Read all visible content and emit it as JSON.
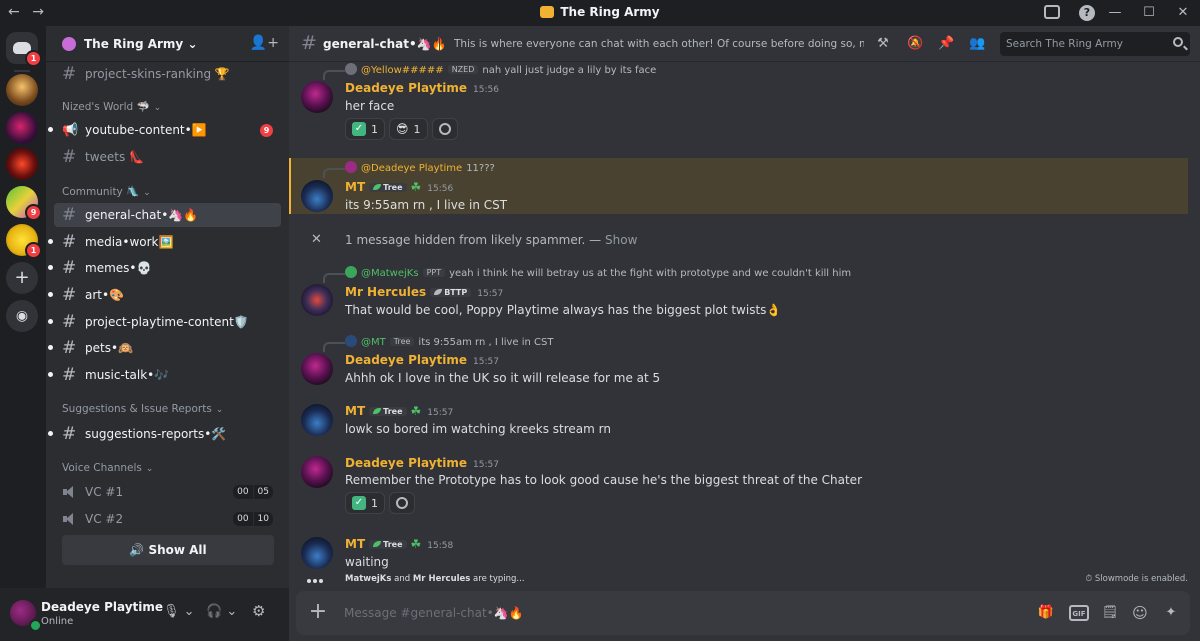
{
  "window": {
    "title": "The Ring Army",
    "back": "←",
    "forward": "→",
    "help": "?",
    "minimize": "—",
    "maximize": "☐",
    "close": "✕"
  },
  "servers": {
    "badges": [
      "1",
      "9",
      "1"
    ],
    "add": "+",
    "discover": "◉"
  },
  "server": {
    "name": "The Ring Army",
    "chevron": "⌄",
    "invite": "👤+"
  },
  "sidebar": {
    "channels_top": [
      {
        "label": "project-skins-ranking 🏆"
      }
    ],
    "categories": {
      "nized": "Nized's World 🦈",
      "community": "Community 🛝",
      "suggestions": "Suggestions & Issue Reports",
      "voice": "Voice Channels"
    },
    "nized_channels": [
      {
        "label": "youtube-content•▶️",
        "count": "9"
      },
      {
        "label": "tweets 👠"
      }
    ],
    "community_channels": [
      {
        "label": "general-chat•🦄🔥"
      },
      {
        "label": "media•work🖼️"
      },
      {
        "label": "memes•💀"
      },
      {
        "label": "art•🎨"
      },
      {
        "label": "project-playtime-content🛡️"
      },
      {
        "label": "pets•🙉"
      },
      {
        "label": "music-talk•🎶"
      }
    ],
    "suggestion_channels": [
      {
        "label": "suggestions-reports•🛠️"
      }
    ],
    "voice_channels": [
      {
        "label": "VC #1",
        "a": "00",
        "b": "05"
      },
      {
        "label": "VC #2",
        "a": "00",
        "b": "10"
      }
    ],
    "show_all": "🔊 Show All"
  },
  "user": {
    "name": "Deadeye Playtime",
    "status": "Online",
    "mic": "🎙 ⌄",
    "headset": "🎧 ⌄",
    "settings": "⚙"
  },
  "chat": {
    "channel_name": "general-chat•🦄🔥",
    "topic": "This is where everyone can chat with each other! Of course before doing so, make sur...",
    "search_placeholder": "Search The Ring Army",
    "header_icons": [
      "⚒",
      "🔕",
      "📌",
      "👥"
    ]
  },
  "messages": [
    {
      "reply": {
        "name": "@Yellow#####",
        "tag": "NZED",
        "text": "nah yall just judge a lily by its face"
      },
      "author": "Deadeye Playtime",
      "time": "15:56",
      "text": "her face",
      "reactions": [
        {
          "emoji": "✓",
          "count": "1"
        },
        {
          "emoji": "😎",
          "count": "1"
        }
      ]
    },
    {
      "reply": {
        "name": "@Deadeye Playtime",
        "text": "11???"
      },
      "author": "MT",
      "tag": "Tree",
      "clover": "☘",
      "time": "15:56",
      "text": "its 9:55am rn , I live in CST"
    },
    {
      "hidden": "1 message hidden from likely spammer. — ",
      "show": "Show",
      "x": "✕"
    },
    {
      "reply": {
        "name": "@MatwejKs",
        "tag": "PPT",
        "text": "yeah i think he will betray us at the fight with prototype and we couldn't kill him"
      },
      "author": "Mr Hercules",
      "tag": "BTTP",
      "time": "15:57",
      "text": "That would be cool, Poppy Playtime always has the biggest plot twists👌"
    },
    {
      "reply": {
        "name": "@MT",
        "tag": "Tree",
        "text": "its 9:55am rn , I live in CST"
      },
      "author": "Deadeye Playtime",
      "time": "15:57",
      "text": "Ahhh ok I love in the UK so it will release for me at 5"
    },
    {
      "author": "MT",
      "tag": "Tree",
      "clover": "☘",
      "time": "15:57",
      "text": "lowk so bored im watching kreeks stream rn"
    },
    {
      "author": "Deadeye Playtime",
      "time": "15:57",
      "text": "Remember the Prototype has to look good cause he's the biggest threat of the Chater",
      "reactions": [
        {
          "emoji": "✓",
          "count": "1"
        }
      ]
    },
    {
      "author": "MT",
      "tag": "Tree",
      "clover": "☘",
      "time": "15:58",
      "text": "waiting"
    }
  ],
  "typing": {
    "user1": "MatwejKs",
    "and": " and ",
    "user2": "Mr Hercules",
    "suffix": " are typing...",
    "slowmode": "⏱ Slowmode is enabled."
  },
  "composer": {
    "placeholder": "Message #general-chat•🦄🔥",
    "plus": "+",
    "gif": "GIF",
    "icons": [
      "🎁",
      "🗒",
      "☺",
      "✦"
    ]
  },
  "colors": {
    "accent": "#f0b232",
    "mention_green": "#4ec068",
    "badge_red": "#f23f43"
  }
}
